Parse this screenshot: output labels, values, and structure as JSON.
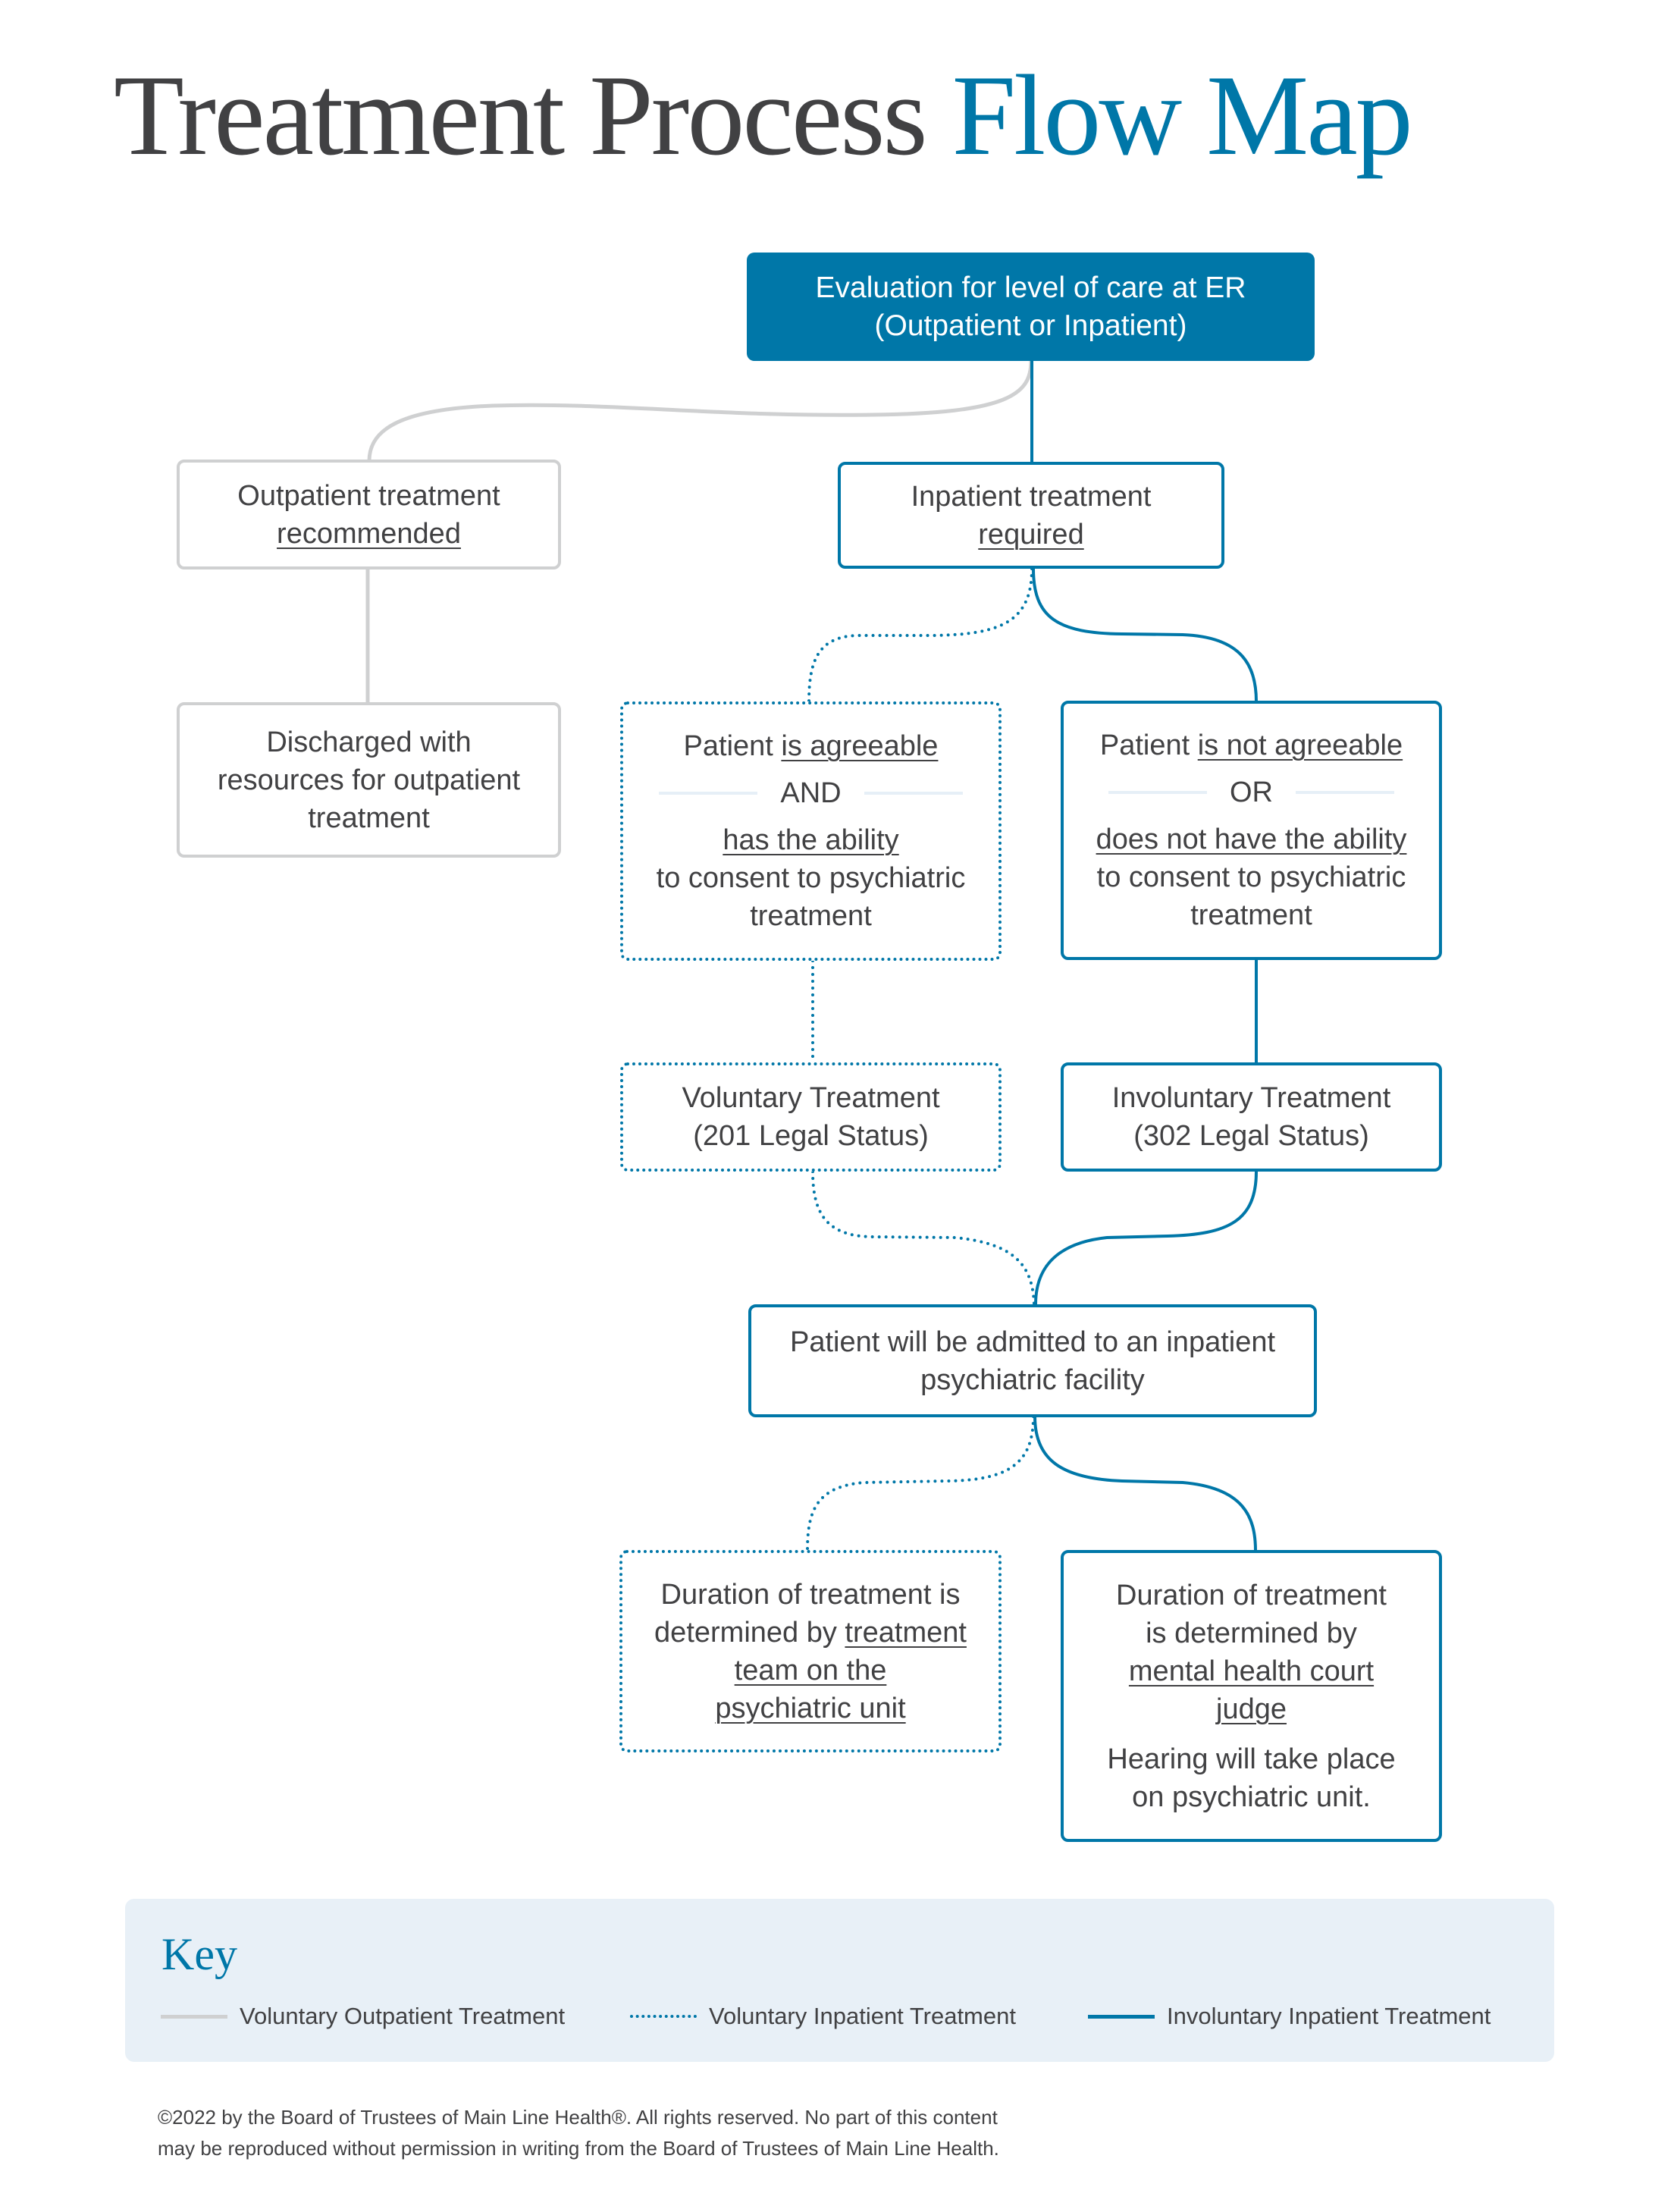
{
  "title": {
    "main": "Treatment Process",
    "accent": "Flow Map"
  },
  "colors": {
    "accent": "#0077a8",
    "text": "#414143",
    "outpatient_line": "#cfd0d1",
    "key_bg": "#e8f0f7"
  },
  "nodes": {
    "evaluation": {
      "line1": "Evaluation for level of care at ER",
      "line2": "(Outpatient or Inpatient)"
    },
    "outpatient": {
      "line1": "Outpatient treatment",
      "line2": "recommended"
    },
    "inpatient": {
      "line1": "Inpatient treatment",
      "line2": "required"
    },
    "discharged": {
      "line1": "Discharged with",
      "line2": "resources for outpatient",
      "line3": "treatment"
    },
    "agreeable": {
      "prefix": "Patient ",
      "emph": "is agreeable",
      "conjunction": "AND",
      "ability": "has the ability",
      "line4": "to consent to psychiatric",
      "line5": "treatment"
    },
    "not_agreeable": {
      "prefix": "Patient ",
      "emph": "is not agreeable",
      "conjunction": "OR",
      "ability": "does not have the ability",
      "line4": "to consent to psychiatric",
      "line5": "treatment"
    },
    "voluntary": {
      "line1": "Voluntary Treatment",
      "line2": "(201 Legal Status)"
    },
    "involuntary": {
      "line1": "Involuntary Treatment",
      "line2": "(302 Legal Status)"
    },
    "admitted": {
      "line1": "Patient will be admitted to an inpatient",
      "line2": "psychiatric facility"
    },
    "duration_voluntary": {
      "line1": "Duration of treatment is",
      "line2_prefix": "determined by ",
      "line2_emph": "treatment",
      "line3": "team on the",
      "line4": "psychiatric unit"
    },
    "duration_involuntary": {
      "line1": "Duration of treatment",
      "line2": "is determined by",
      "line3": "mental health court",
      "line4": "judge",
      "line5": "Hearing will take place",
      "line6": "on psychiatric unit."
    }
  },
  "key": {
    "title": "Key",
    "items": [
      {
        "label": "Voluntary Outpatient Treatment",
        "style": "gray-solid"
      },
      {
        "label": "Voluntary Inpatient Treatment",
        "style": "blue-dotted"
      },
      {
        "label": "Involuntary Inpatient Treatment",
        "style": "blue-solid"
      }
    ]
  },
  "copyright": {
    "line1": "©2022 by the Board of Trustees of Main Line Health®. All rights reserved. No part of this content",
    "line2": "may be reproduced without permission in writing from the Board of Trustees of Main Line Health."
  }
}
